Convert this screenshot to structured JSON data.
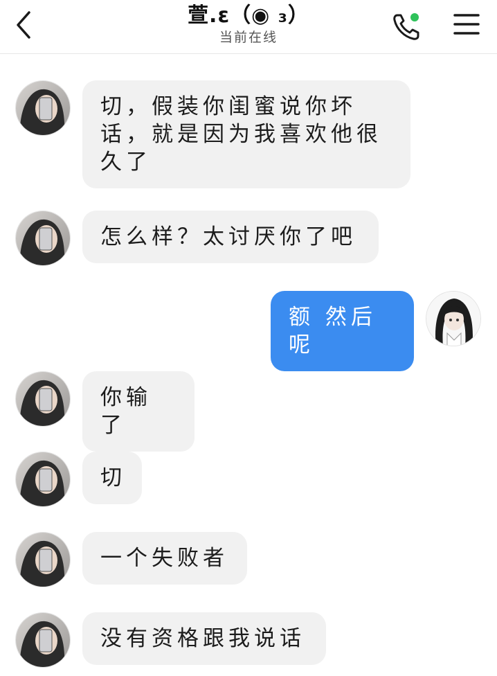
{
  "header": {
    "title": "萱.ε（◉ ₃）",
    "status": "当前在线",
    "online_dot_color": "#2fc25b",
    "back_icon": "chevron-left-icon",
    "call_icon": "phone-icon",
    "menu_icon": "hamburger-menu-icon"
  },
  "colors": {
    "incoming_bubble": "#f1f1f1",
    "outgoing_bubble": "#3b8cf0",
    "outgoing_text": "#ffffff"
  },
  "messages": [
    {
      "side": "in",
      "text": "切，假装你闺蜜说你坏话，就是因为我喜欢他很久了"
    },
    {
      "side": "in",
      "text": "怎么样？太讨厌你了吧"
    },
    {
      "side": "out",
      "text": "额 然后呢"
    },
    {
      "side": "in",
      "text": "你输了"
    },
    {
      "side": "in",
      "text": "切"
    },
    {
      "side": "in",
      "text": "一个失败者"
    },
    {
      "side": "in",
      "text": "没有资格跟我说话"
    }
  ]
}
